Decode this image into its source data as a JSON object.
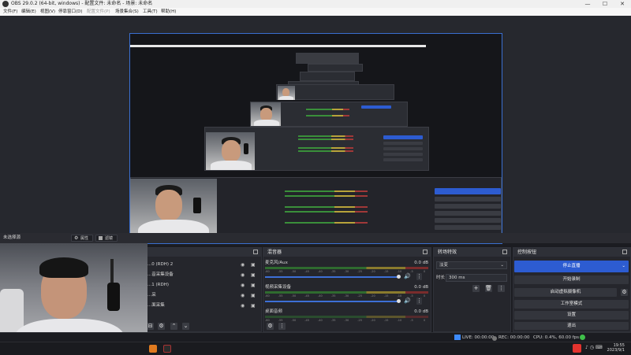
{
  "window": {
    "title": "OBS 29.0.2 (64-bit, windows) - 配置文件: 未命名 - 场景: 未命名",
    "controls": [
      "—",
      "☐",
      "✕"
    ]
  },
  "menu": [
    {
      "label": "文件(F)",
      "enabled": true
    },
    {
      "label": "编辑(E)",
      "enabled": true
    },
    {
      "label": "视图(V)",
      "enabled": true
    },
    {
      "label": "停靠窗口(D)",
      "enabled": true
    },
    {
      "label": "配置文件(P)",
      "enabled": false
    },
    {
      "label": "场景集合(S)",
      "enabled": true
    },
    {
      "label": "工具(T)",
      "enabled": true
    },
    {
      "label": "帮助(H)",
      "enabled": true
    }
  ],
  "toolbar": {
    "no_source": "未选择源",
    "properties": "属性",
    "filters": "滤镜"
  },
  "sources": {
    "items": [
      {
        "name": "...0 (RDH) 2",
        "visible": true,
        "locked": true
      },
      {
        "name": "...音采集设备",
        "visible": true,
        "locked": true
      },
      {
        "name": "...1 (RDH)",
        "visible": true,
        "locked": true
      },
      {
        "name": "...采",
        "visible": true,
        "locked": true
      },
      {
        "name": "...面采集",
        "visible": true,
        "locked": true
      }
    ]
  },
  "mixer": {
    "title": "混音器",
    "channels": [
      {
        "name": "麦克风/Aux",
        "db": "0.0 dB",
        "level": 0.78
      },
      {
        "name": "视频采集设备",
        "db": "0.0 dB",
        "level": 0.78
      },
      {
        "name": "桌面音频",
        "db": "0.0 dB",
        "level": 0.0
      }
    ],
    "ticks": [
      "-60",
      "-55",
      "-50",
      "-45",
      "-40",
      "-35",
      "-30",
      "-25",
      "-20",
      "-15",
      "-10",
      "-5",
      "0"
    ]
  },
  "transitions": {
    "title": "转场特效",
    "type": "淡变",
    "duration_label": "时长",
    "duration_value": "300 ms"
  },
  "controls": {
    "title": "控制按钮",
    "buttons": [
      {
        "label": "停止直播",
        "primary": true
      },
      {
        "label": "开始录制",
        "primary": false
      },
      {
        "label": "启动虚拟摄像机",
        "primary": false
      },
      {
        "label": "工作室模式",
        "primary": false
      },
      {
        "label": "设置",
        "primary": false
      },
      {
        "label": "退出",
        "primary": false
      }
    ]
  },
  "status": {
    "live": "LIVE: 00:00:00",
    "rec": "REC: 00:00:00",
    "cpu": "CPU: 0.4%, 60.00 fps"
  },
  "taskbar": {
    "time": "19:55",
    "date": "2023/9/1"
  },
  "colors": {
    "accent": "#2d5cd1",
    "preview_border": "#3a6fd0",
    "live": "#3d8bfd"
  }
}
